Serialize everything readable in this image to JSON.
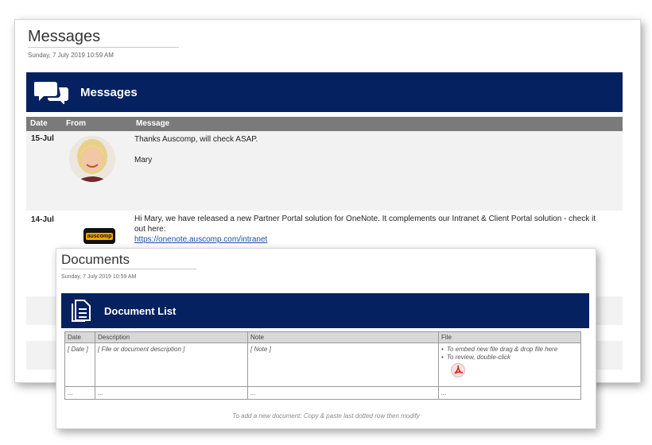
{
  "messages_page": {
    "title": "Messages",
    "datetime": "Sunday, 7 July 2019   10:59 AM",
    "banner_title": "Messages",
    "columns": [
      "Date",
      "From",
      "Message"
    ],
    "rows": [
      {
        "date": "15-Jul",
        "lines": [
          "Thanks Auscomp, will check ASAP.",
          "",
          "Mary"
        ]
      },
      {
        "date": "14-Jul",
        "lines": [
          "Hi Mary, we have released a new Partner Portal solution for OneNote. It complements our Intranet & Client Portal solution - check it",
          "out here:"
        ],
        "link": "https://onenote.auscomp.com/intranet",
        "logo_text": "auscomp"
      }
    ]
  },
  "documents_page": {
    "title": "Documents",
    "datetime": "Sunday, 7 July 2019   10:59 AM",
    "banner_title": "Document List",
    "columns": [
      "Date",
      "Description",
      "Note",
      "File"
    ],
    "row": {
      "date": "[ Date ]",
      "description": "[ File or document description ]",
      "note": "[ Note ]",
      "file_bullets": [
        "To embed new file drag & drop file here",
        "To review, double-click"
      ]
    },
    "dotted_row": [
      "...",
      "...",
      "...",
      "..."
    ],
    "footer": "To add a new document: Copy & paste last dotted row then modify"
  },
  "colors": {
    "banner": "#06215f",
    "header_gray": "#7a7a7a",
    "row_bg": "#f2f2f2",
    "link": "#1a4ea8",
    "pdf_red": "#d42a1e"
  }
}
